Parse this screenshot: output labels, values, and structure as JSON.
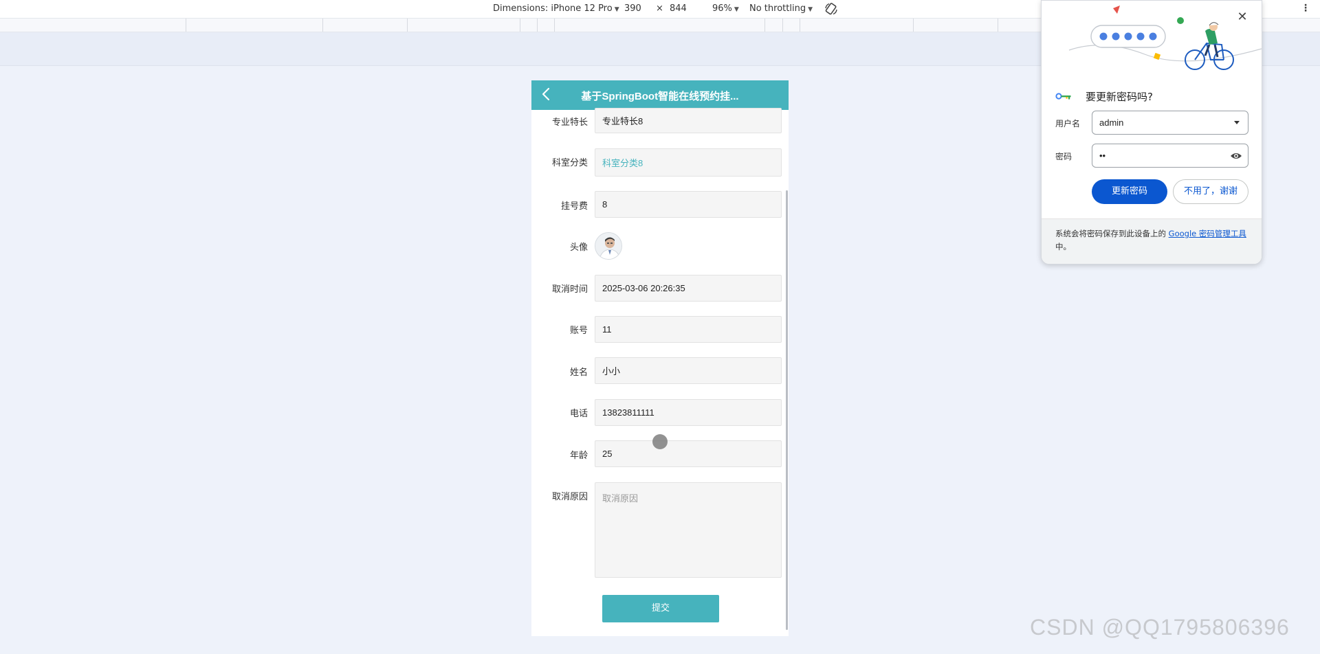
{
  "devtools": {
    "dimensions_label": "Dimensions: iPhone 12 Pro",
    "width": "390",
    "times": "×",
    "height": "844",
    "zoom": "96%",
    "throttling": "No throttling"
  },
  "app": {
    "title": "基于SpringBoot智能在线预约挂...",
    "fields": [
      {
        "label": "专业特长",
        "value": "专业特长8"
      },
      {
        "label": "科室分类",
        "value": "科室分类8"
      },
      {
        "label": "挂号费",
        "value": "8"
      },
      {
        "label": "头像",
        "value": ""
      },
      {
        "label": "取消时间",
        "value": "2025-03-06 20:26:35"
      },
      {
        "label": "账号",
        "value": "11"
      },
      {
        "label": "姓名",
        "value": "小小"
      },
      {
        "label": "电话",
        "value": "13823811111"
      },
      {
        "label": "年龄",
        "value": "25"
      },
      {
        "label": "取消原因",
        "placeholder": "取消原因"
      }
    ],
    "submit_label": "提交",
    "accent_color": "#46b3bd"
  },
  "password_popup": {
    "title": "要更新密码吗?",
    "username_label": "用户名",
    "username_value": "admin",
    "password_label": "密码",
    "password_value": "••",
    "update_label": "更新密码",
    "dismiss_label": "不用了，谢谢",
    "footer_text": "系统会将密码保存到此设备上的",
    "footer_link": "Google 密码管理工具",
    "footer_suffix": "中。",
    "primary_color": "#0b57d0"
  },
  "watermark": "CSDN @QQ1795806396"
}
